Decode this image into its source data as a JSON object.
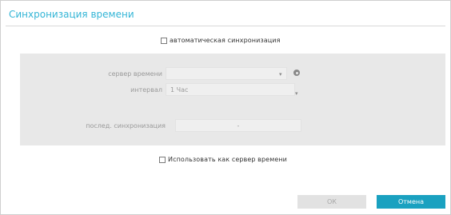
{
  "dialog": {
    "title": "Синхронизация времени",
    "auto_sync_label": "автоматическая синхронизация",
    "auto_sync_checked": false,
    "server_label": "сервер времени",
    "server_value": "",
    "interval_label": "интервал",
    "interval_value": "1 Час",
    "last_sync_label": "послед. синхронизация",
    "last_sync_value": "-",
    "use_as_server_label": "Использовать как сервер времени",
    "use_as_server_checked": false,
    "ok_label": "ОК",
    "cancel_label": "Отмена",
    "colors": {
      "title": "#33b5d6",
      "cancel_bg": "#1aa1c0",
      "panel_bg": "#e8e8e8"
    },
    "icons": [
      "settings-gear-icon",
      "chevron-down-icon"
    ]
  }
}
